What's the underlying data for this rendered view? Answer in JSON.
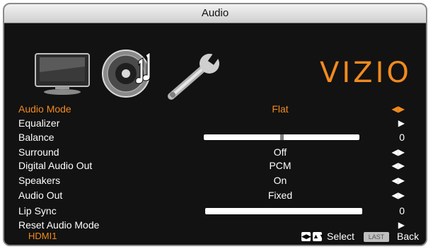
{
  "window": {
    "title": "Audio"
  },
  "logo": {
    "text": "VIZIO"
  },
  "icons": [
    "tv-icon",
    "speaker-icon",
    "wrench-icon"
  ],
  "menu": {
    "items": [
      {
        "label": "Audio Mode",
        "value": "Flat",
        "control": "left-right-arrows",
        "selected": true
      },
      {
        "label": "Equalizer",
        "value": "",
        "control": "right-arrow"
      },
      {
        "label": "Balance",
        "value": "0",
        "control": "slider",
        "slider_fraction": 0.5
      },
      {
        "label": "Surround",
        "value": "Off",
        "control": "left-right-arrows"
      },
      {
        "label": "Digital Audio Out",
        "value": "PCM",
        "control": "left-right-arrows"
      },
      {
        "label": "Speakers",
        "value": "On",
        "control": "left-right-arrows"
      },
      {
        "label": "Audio Out",
        "value": "Fixed",
        "control": "left-right-arrows"
      },
      {
        "label": "Lip Sync",
        "value": "0",
        "control": "slider",
        "slider_fraction": 0.0
      },
      {
        "label": "Reset Audio Mode",
        "value": "",
        "control": "right-arrow"
      }
    ]
  },
  "footer": {
    "input": "HDMI1",
    "select_label": "Select",
    "last_key_label": "LAST",
    "back_label": "Back"
  },
  "colors": {
    "accent": "#f28a1f",
    "background": "#121212",
    "text": "#ffffff"
  }
}
